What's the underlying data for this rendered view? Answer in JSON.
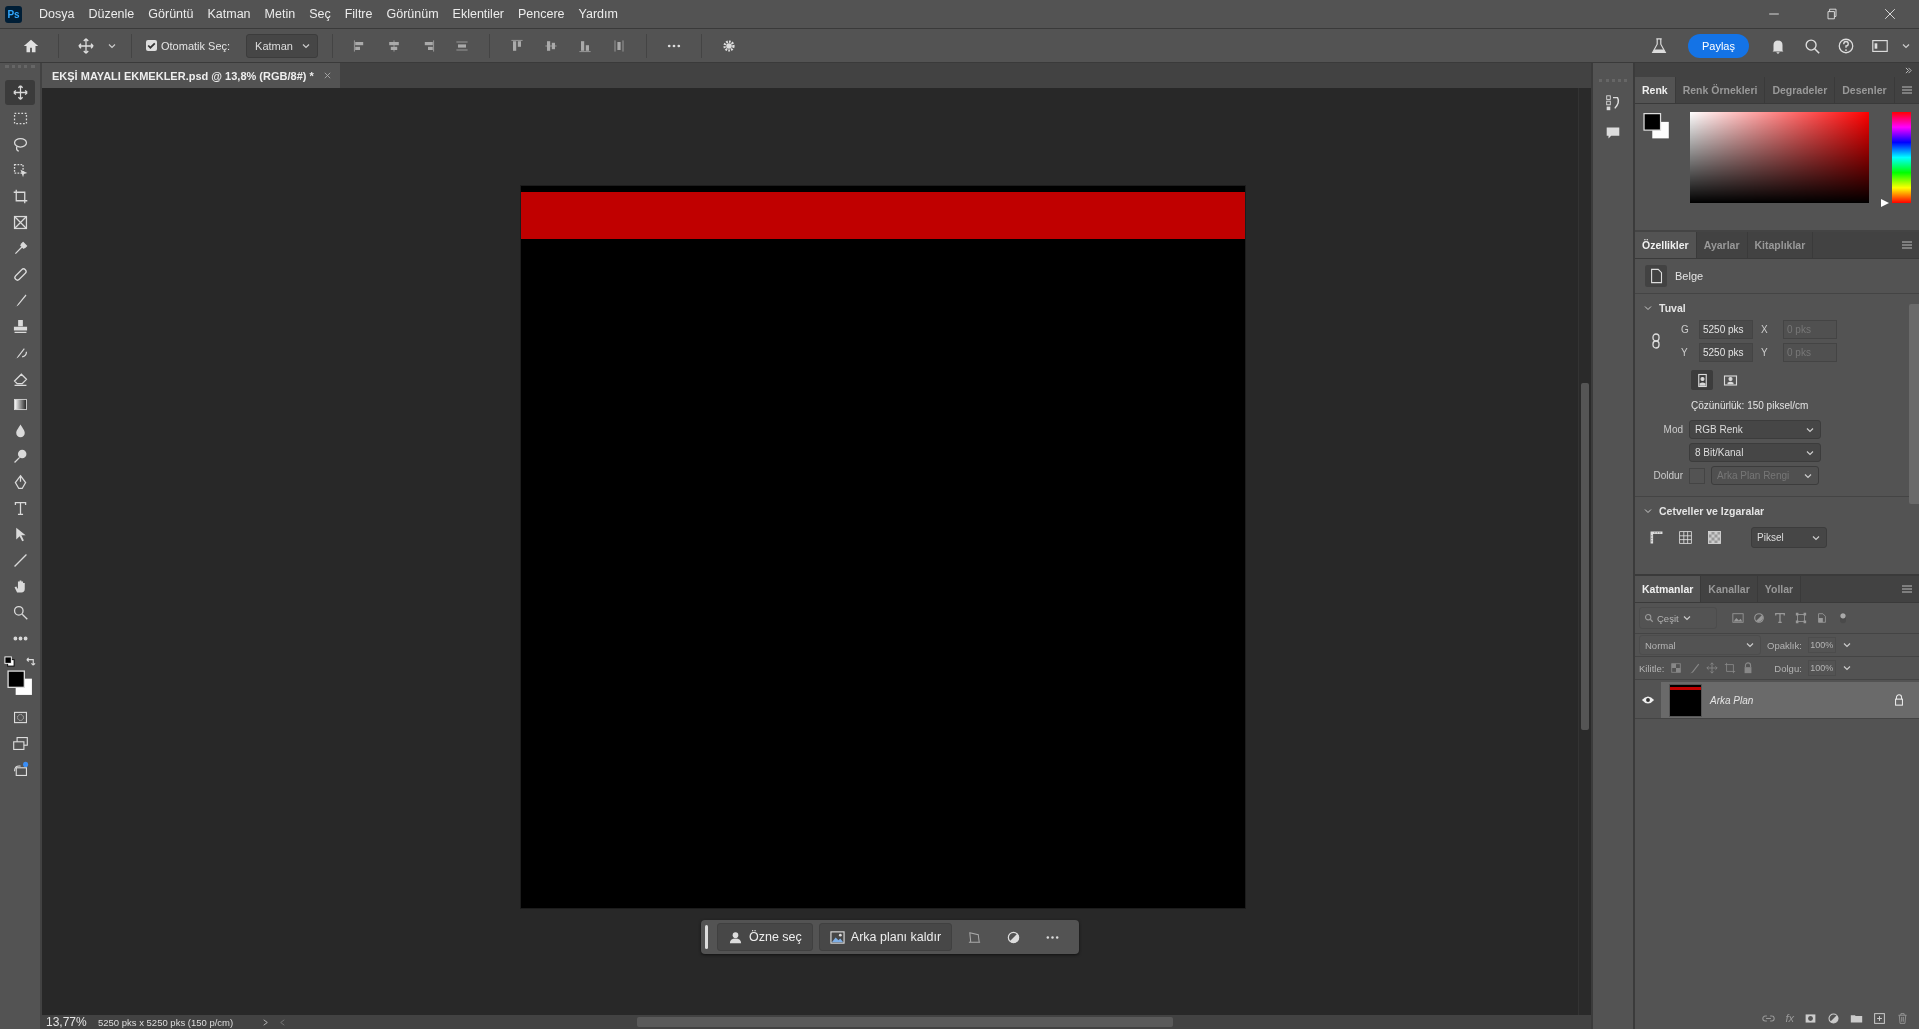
{
  "app_icon": "Ps",
  "menu": [
    "Dosya",
    "Düzenle",
    "Görüntü",
    "Katman",
    "Metin",
    "Seç",
    "Filtre",
    "Görünüm",
    "Eklentiler",
    "Pencere",
    "Yardım"
  ],
  "options_bar": {
    "auto_select_label": "Otomatik Seç:",
    "auto_select_checked": true,
    "target": "Katman"
  },
  "share_button": "Paylaş",
  "document_tab": {
    "title": "EKŞİ MAYALI EKMEKLER.psd @ 13,8% (RGB/8#) *"
  },
  "tools": [
    {
      "kind": "move",
      "selected": true
    },
    {
      "kind": "marquee",
      "selected": false
    },
    {
      "kind": "lasso",
      "selected": false
    },
    {
      "kind": "object-select",
      "selected": false
    },
    {
      "kind": "crop",
      "selected": false
    },
    {
      "kind": "frame",
      "selected": false
    },
    {
      "kind": "eyedropper",
      "selected": false
    },
    {
      "kind": "bandage",
      "selected": false
    },
    {
      "kind": "brush",
      "selected": false
    },
    {
      "kind": "stamp",
      "selected": false
    },
    {
      "kind": "history-brush",
      "selected": false
    },
    {
      "kind": "eraser",
      "selected": false
    },
    {
      "kind": "gradient",
      "selected": false
    },
    {
      "kind": "drop",
      "selected": false
    },
    {
      "kind": "dodge",
      "selected": false
    },
    {
      "kind": "pen",
      "selected": false
    },
    {
      "kind": "type",
      "selected": false
    },
    {
      "kind": "pointer",
      "selected": false
    },
    {
      "kind": "line",
      "selected": false
    },
    {
      "kind": "hand",
      "selected": false
    },
    {
      "kind": "zoom",
      "selected": false
    },
    {
      "kind": "more",
      "selected": false
    }
  ],
  "contextual_bar": {
    "buttons": [
      "Özne seç",
      "Arka planı kaldır"
    ]
  },
  "status_bar": {
    "zoom": "13,77%",
    "info": "5250 pks x 5250 pks (150 p/cm)"
  },
  "color_panel": {
    "hue_slider": {
      "level": 0
    },
    "tabs": [
      {
        "label": "Renk",
        "selected": true
      },
      {
        "label": "Renk Örnekleri",
        "selected": false
      },
      {
        "label": "Degradeler",
        "selected": false
      },
      {
        "label": "Desenler",
        "selected": false
      }
    ]
  },
  "properties_panel": {
    "tabs": [
      {
        "label": "Özellikler",
        "selected": true
      },
      {
        "label": "Ayarlar",
        "selected": false
      },
      {
        "label": "Kitaplıklar",
        "selected": false
      }
    ],
    "type": "Belge",
    "canvas": {
      "title": "Tuval",
      "expanded": true,
      "width_label": "G",
      "width": "5250 pks",
      "height_label": "Y",
      "height": "5250 pks",
      "x_label": "X",
      "x": "0 pks",
      "y_label": "Y",
      "y": "0 pks",
      "orientations": [
        {
          "kind": "portrait",
          "selected": true
        },
        {
          "kind": "landscape",
          "selected": false
        }
      ],
      "resolution": "Çözünürlük: 150 piksel/cm",
      "mode_label": "Mod",
      "mode": "RGB Renk",
      "depth": "8 Bit/Kanal",
      "fill_label": "Doldur",
      "fill": "Arka Plan Rengi",
      "fill_disabled": true
    },
    "rulers": {
      "title": "Cetveller ve Izgaralar",
      "expanded": true,
      "unit": "Piksel"
    }
  },
  "layers_panel": {
    "tabs": [
      {
        "label": "Katmanlar",
        "selected": true
      },
      {
        "label": "Kanallar",
        "selected": false
      },
      {
        "label": "Yollar",
        "selected": false
      }
    ],
    "filter_placeholder": "Çeşit",
    "blend_mode": "Normal",
    "opacity_label": "Opaklık:",
    "opacity": "100%",
    "lock_label": "Kilitle:",
    "fill_label": "Dolgu:",
    "fill": "100%",
    "layers": [
      {
        "name": "Arka Plan",
        "visible": true,
        "locked": true,
        "selected": true
      }
    ],
    "fx_label": "fx"
  }
}
